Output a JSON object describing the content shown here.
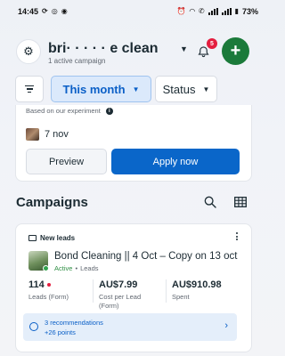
{
  "status_bar": {
    "time": "14:45",
    "battery": "73%"
  },
  "header": {
    "account_name": "bri·  · · · · e clean",
    "account_sub": "1 active campaign",
    "notification_count": "5",
    "create_label": "+"
  },
  "filters": {
    "date_label": "This month",
    "status_label": "Status"
  },
  "recommendation": {
    "experiment_note": "Based on our experiment",
    "date": "7 nov",
    "preview_label": "Preview",
    "apply_label": "Apply now"
  },
  "campaigns": {
    "title": "Campaigns",
    "card": {
      "objective": "New leads",
      "name": "Bond Cleaning || 4 Oct – Copy on 13 oct",
      "status": "Active",
      "objective_type": "Leads",
      "metrics": [
        {
          "value": "114",
          "label": "Leads (Form)"
        },
        {
          "value": "AU$7.99",
          "label": "Cost per Lead (Form)"
        },
        {
          "value": "AU$910.98",
          "label": "Spent"
        }
      ],
      "recommendations_count": "3 recommendations",
      "recommendations_points": "+26 points"
    }
  },
  "colors": {
    "primary": "#0a66c9",
    "create": "#1b7a3a",
    "badge": "#e41e3f",
    "active": "#31a24c"
  }
}
